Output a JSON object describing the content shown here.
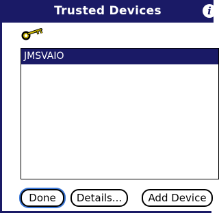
{
  "window": {
    "title": "Trusted Devices",
    "info_glyph": "i"
  },
  "icons": {
    "key": "key-icon",
    "info": "info-icon"
  },
  "devices": [
    {
      "name": "JMSVAIO",
      "selected": true
    }
  ],
  "buttons": {
    "done": "Done",
    "details": "Details...",
    "add_device": "Add Device"
  },
  "colors": {
    "titlebar": "#1a1a66",
    "selection": "#1a1a66",
    "focus_ring": "#3c78d8",
    "key": "#c8b400"
  }
}
